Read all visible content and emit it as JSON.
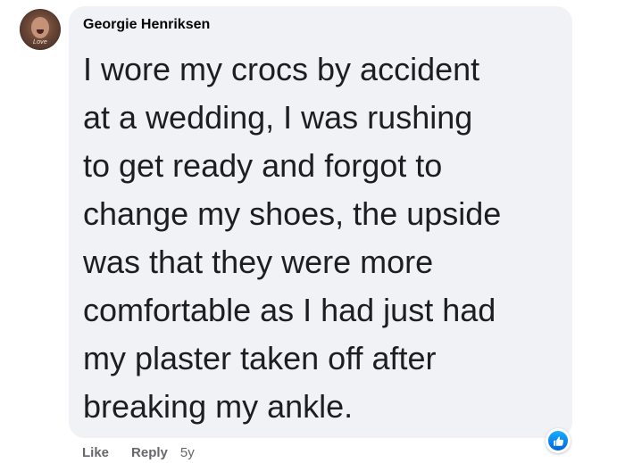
{
  "comment": {
    "author": "Georgie Henriksen",
    "avatar_caption": "Love",
    "text": "I wore my crocs by accident\nat a wedding, I was rushing\nto get ready and forgot to\nchange my shoes, the upside\nwas that they were more\ncomfortable as I had just had\nmy plaster taken off after\nbreaking my ankle.",
    "reaction_icon": "like-thumbs-up-icon"
  },
  "actions": {
    "like_label": "Like",
    "reply_label": "Reply",
    "timestamp": "5y"
  },
  "colors": {
    "bubble_background": "#f0f2f5",
    "author_text": "#050505",
    "body_text": "#1c1e21",
    "action_text": "#65676b",
    "like_blue": "#0866ff"
  }
}
